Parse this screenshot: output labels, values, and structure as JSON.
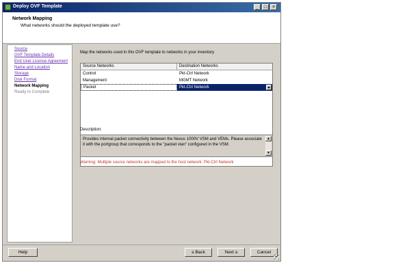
{
  "window": {
    "title": "Deploy OVF Template",
    "controls": {
      "minimize": "_",
      "maximize": "□",
      "close": "×"
    }
  },
  "header": {
    "title": "Network Mapping",
    "subtitle": "What networks should the deployed template use?"
  },
  "nav": {
    "items": [
      {
        "label": "Source",
        "state": "link"
      },
      {
        "label": "OVF Template Details",
        "state": "link"
      },
      {
        "label": "End User License Agreement",
        "state": "link"
      },
      {
        "label": "Name and Location",
        "state": "link"
      },
      {
        "label": "Storage",
        "state": "link"
      },
      {
        "label": "Disk Format",
        "state": "link"
      },
      {
        "label": "Network Mapping",
        "state": "active"
      },
      {
        "label": "Ready to Complete",
        "state": "disabled"
      }
    ]
  },
  "main": {
    "instruction": "Map the networks used in this OVF template to networks in your inventory",
    "table": {
      "headers": [
        "Source Networks",
        "Destination Networks"
      ],
      "rows": [
        {
          "source": "Control",
          "destination": "Pkt-Ctrl Network",
          "selected": false
        },
        {
          "source": "Management",
          "destination": "MGMT Network",
          "selected": false
        },
        {
          "source": "Packet",
          "destination": "Pkt-Ctrl Network",
          "selected": true
        }
      ]
    },
    "description_label": "Description:",
    "description_text": "Provides internal packet connectivity between the Nexus 1000V VSM and VEMs. Please associate it with the portgroup that corresponds to the \"packet vlan\" configured in the VSM.",
    "warning": "Warning: Multiple source networks are mapped to the host network: Pkt-Ctrl Network"
  },
  "buttons": {
    "help": "Help",
    "back": "≤ Back",
    "next": "Next ≥",
    "cancel": "Cancel"
  },
  "colors": {
    "titlebar": "#0a246a",
    "selection": "#0a246a",
    "link": "#6b2fae",
    "warning": "#c0392b"
  }
}
